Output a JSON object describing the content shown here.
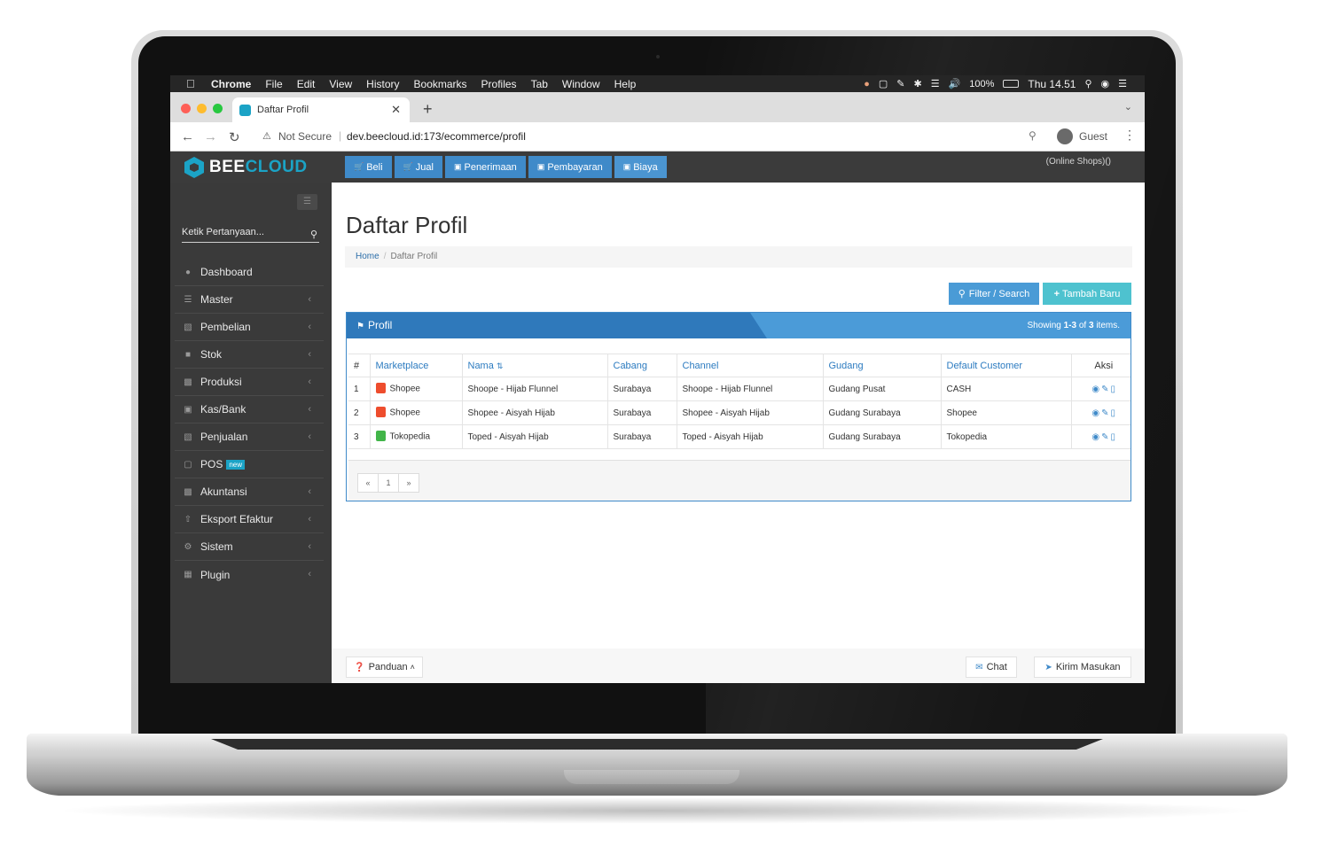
{
  "mac_menu": {
    "items": [
      "Chrome",
      "File",
      "Edit",
      "View",
      "History",
      "Bookmarks",
      "Profiles",
      "Tab",
      "Window",
      "Help"
    ],
    "battery": "100%",
    "clock": "Thu 14.51"
  },
  "browser": {
    "tab_title": "Daftar Profil",
    "not_secure": "Not Secure",
    "url": "dev.beecloud.id:173/ecommerce/profil",
    "profile": "Guest"
  },
  "app": {
    "logo_part1": "BEE",
    "logo_part2": "CLOUD",
    "topnav": [
      "Beli",
      "Jual",
      "Penerimaan",
      "Pembayaran",
      "Biaya"
    ],
    "online_shops": "(Online Shops)()"
  },
  "sidebar": {
    "search_placeholder": "Ketik Pertanyaan...",
    "items": [
      {
        "label": "Dashboard",
        "icon": "dashboard-icon",
        "chevron": false
      },
      {
        "label": "Master",
        "icon": "database-icon",
        "chevron": true
      },
      {
        "label": "Pembelian",
        "icon": "cart-icon",
        "chevron": true
      },
      {
        "label": "Stok",
        "icon": "box-icon",
        "chevron": true
      },
      {
        "label": "Produksi",
        "icon": "bar-chart-icon",
        "chevron": true
      },
      {
        "label": "Kas/Bank",
        "icon": "money-icon",
        "chevron": true
      },
      {
        "label": "Penjualan",
        "icon": "cart-icon",
        "chevron": true
      },
      {
        "label": "POS",
        "icon": "monitor-icon",
        "chevron": false,
        "badge": "new"
      },
      {
        "label": "Akuntansi",
        "icon": "chart-icon",
        "chevron": true
      },
      {
        "label": "Eksport Efaktur",
        "icon": "upload-icon",
        "chevron": true
      },
      {
        "label": "Sistem",
        "icon": "cogs-icon",
        "chevron": true
      },
      {
        "label": "Plugin",
        "icon": "puzzle-icon",
        "chevron": true
      }
    ]
  },
  "page": {
    "title": "Daftar Profil",
    "breadcrumb_home": "Home",
    "breadcrumb_current": "Daftar Profil",
    "filter_button": "Filter / Search",
    "add_button": "Tambah Baru"
  },
  "panel": {
    "title": "Profil",
    "showing_prefix": "Showing ",
    "showing_range": "1-3",
    "showing_mid": " of ",
    "showing_total": "3",
    "showing_suffix": " items."
  },
  "table": {
    "headers": [
      "#",
      "Marketplace",
      "Nama",
      "Cabang",
      "Channel",
      "Gudang",
      "Default Customer",
      "Aksi"
    ],
    "rows": [
      {
        "no": "1",
        "marketplace": "Shopee",
        "nama": "Shoope - Hijab Flunnel",
        "cabang": "Surabaya",
        "channel": "Shoope - Hijab Flunnel",
        "gudang": "Gudang Pusat",
        "customer": "CASH"
      },
      {
        "no": "2",
        "marketplace": "Shopee",
        "nama": "Shopee - Aisyah Hijab",
        "cabang": "Surabaya",
        "channel": "Shopee - Aisyah Hijab",
        "gudang": "Gudang Surabaya",
        "customer": "Shopee"
      },
      {
        "no": "3",
        "marketplace": "Tokopedia",
        "nama": "Toped - Aisyah Hijab",
        "cabang": "Surabaya",
        "channel": "Toped - Aisyah Hijab",
        "gudang": "Gudang Surabaya",
        "customer": "Tokopedia"
      }
    ]
  },
  "pagination": {
    "prev": "«",
    "page": "1",
    "next": "»"
  },
  "footer": {
    "guide": "Panduan",
    "chat": "Chat",
    "feedback": "Kirim Masukan"
  },
  "colors": {
    "brand": "#1ba3c6",
    "primary": "#3f8ac9",
    "shopee": "#ee4d2d",
    "tokopedia": "#42b549"
  }
}
